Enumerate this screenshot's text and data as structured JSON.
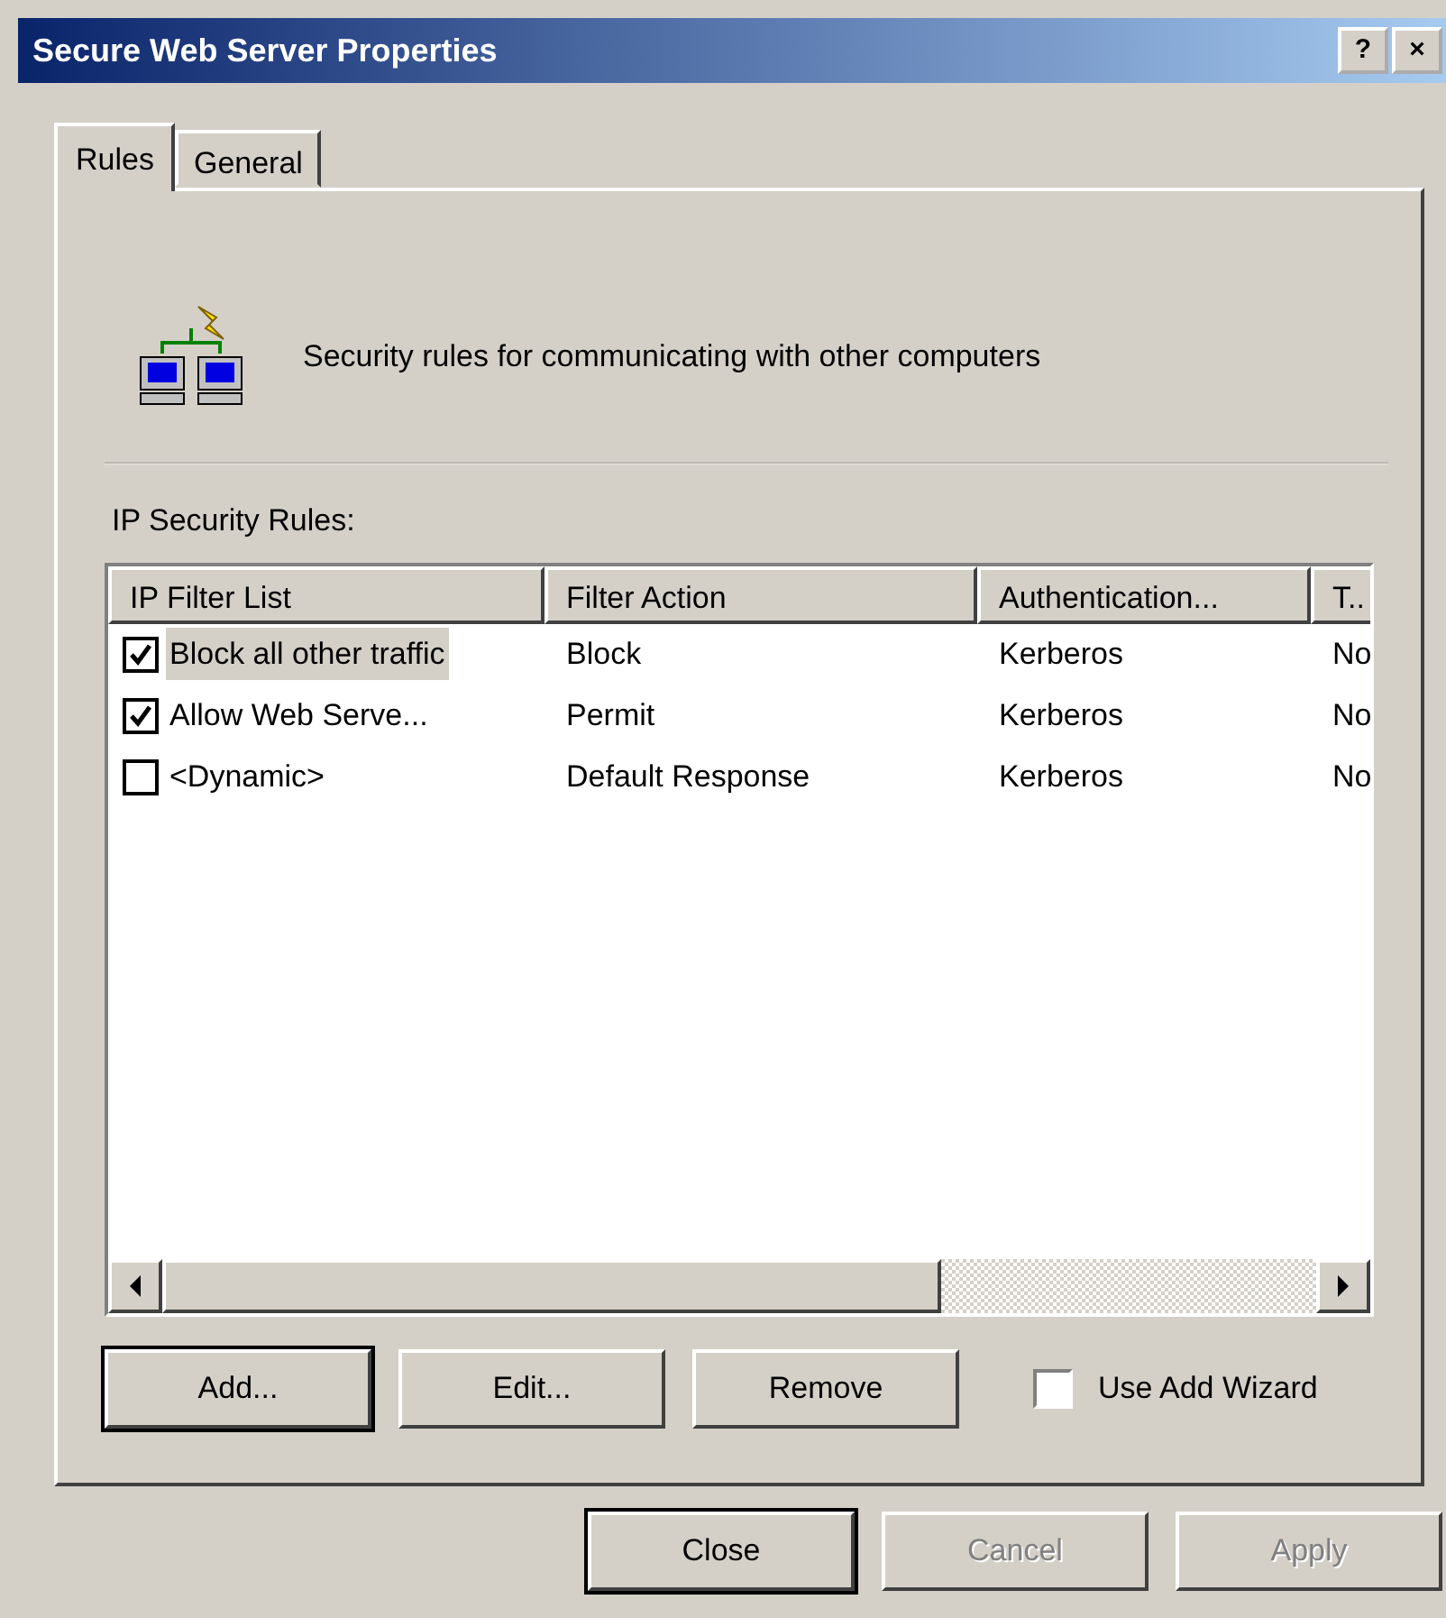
{
  "window": {
    "title": "Secure Web Server Properties",
    "title_buttons": [
      "?",
      "×"
    ]
  },
  "tabs": [
    {
      "label": "Rules",
      "selected": true
    },
    {
      "label": "General",
      "selected": false
    }
  ],
  "description": "Security rules for communicating with other computers",
  "rules_label": "IP Security Rules:",
  "table": {
    "columns": [
      "IP Filter List",
      "Filter Action",
      "Authentication...",
      "T.."
    ],
    "rows": [
      {
        "checked": true,
        "selected": true,
        "cells": [
          "Block all other traffic",
          "Block",
          "Kerberos",
          "No"
        ]
      },
      {
        "checked": true,
        "selected": false,
        "cells": [
          "Allow Web Serve...",
          "Permit",
          "Kerberos",
          "No"
        ]
      },
      {
        "checked": false,
        "selected": false,
        "cells": [
          "<Dynamic>",
          "Default Response",
          "Kerberos",
          "No"
        ]
      }
    ]
  },
  "rule_buttons": [
    {
      "label": "Add...",
      "default": true
    },
    {
      "label": "Edit...",
      "default": false
    },
    {
      "label": "Remove",
      "default": false
    }
  ],
  "wizard": {
    "label": "Use Add Wizard",
    "checked": false
  },
  "dialog_buttons": [
    {
      "label": "Close",
      "disabled": false,
      "default": true
    },
    {
      "label": "Cancel",
      "disabled": true,
      "default": false
    },
    {
      "label": "Apply",
      "disabled": true,
      "default": false
    }
  ]
}
